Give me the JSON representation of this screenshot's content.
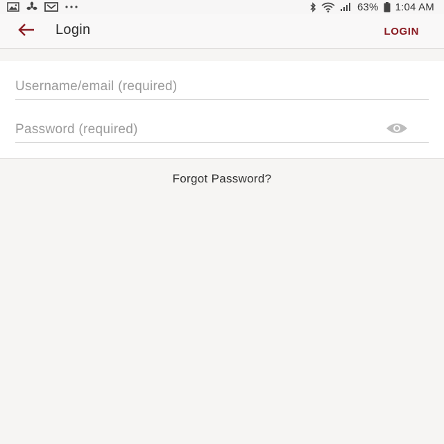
{
  "status_bar": {
    "left_icons": [
      "gallery-icon",
      "fan-icon",
      "mail-icon",
      "more-dots-icon"
    ],
    "right_icons": [
      "bluetooth-icon",
      "wifi-icon",
      "signal-icon",
      "battery-icon"
    ],
    "battery_percent": "63%",
    "time": "1:04 AM"
  },
  "app_bar": {
    "title": "Login",
    "action_label": "LOGIN",
    "back_icon": "back-arrow-icon"
  },
  "form": {
    "username": {
      "placeholder": "Username/email (required)",
      "value": ""
    },
    "password": {
      "placeholder": "Password (required)",
      "value": "",
      "toggle_icon": "eye-icon"
    }
  },
  "forgot_password_label": "Forgot Password?",
  "colors": {
    "accent": "#8a1b22",
    "background": "#f6f5f3",
    "card": "#ffffff",
    "appbar": "#f9f8f8"
  }
}
